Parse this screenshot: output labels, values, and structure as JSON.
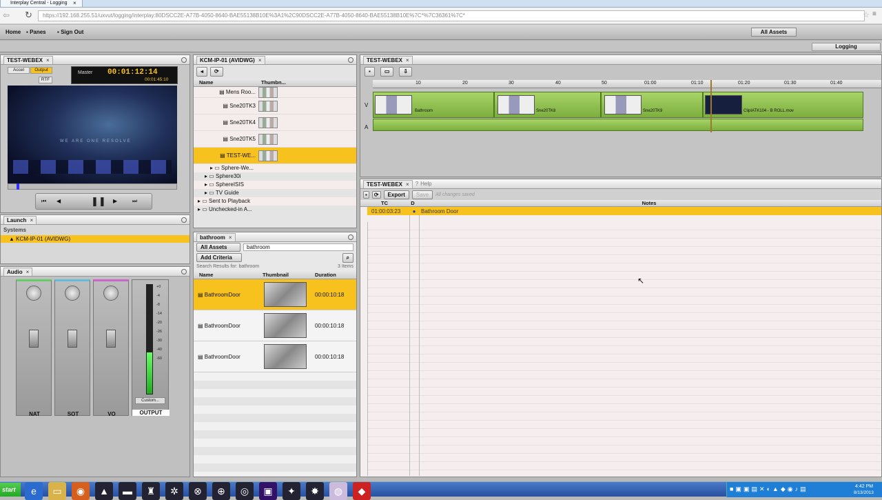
{
  "browser": {
    "tab_title": "Interplay Central - Logging",
    "url": "https://192.168.255.51/uxvut/logging/interplay:80DSCC2E-A77B-4050-8640-BAE55138B10E%3A1%2C90DSCC2E-A77B-4050-8640-BAE55138B10E%7C*%7C36361%7C*"
  },
  "menubar": {
    "home": "Home",
    "panes": "Panes",
    "signout": "Sign Out",
    "assets_dropdown": "All Assets",
    "logging_button": "Logging"
  },
  "player": {
    "tab": "TEST-WEBEX",
    "accel": "Accel",
    "output": "Output",
    "rtf": "RTF",
    "master": "Master",
    "timecode": "00:01:12:14",
    "duration": "00:01:45:10",
    "overlay_text": "WE ARE ONE RESOLVE"
  },
  "launch": {
    "tab": "Launch",
    "systems": "Systems",
    "system_item": "KCM-IP-01 (AVIDWG)"
  },
  "audio": {
    "tab": "Audio",
    "channels": [
      "NAT",
      "SOT",
      "VO"
    ],
    "output": "OUTPUT",
    "custom": "Custom...",
    "meter_scale": [
      "+0",
      "-4",
      "-8",
      "-14",
      "-20",
      "-26",
      "-30",
      "-40",
      "-60"
    ]
  },
  "browse": {
    "tab": "KCM-IP-01 (AVIDWG)",
    "col_name": "Name",
    "col_thumb": "Thumbn...",
    "items": [
      "Mens Roo...",
      "Sne20TK3",
      "Sne20TK4",
      "Sne20TK5",
      "TEST-WE..."
    ],
    "folders": [
      "Sphere-We...",
      "Sphere30i",
      "SphereISIS",
      "TV Guide",
      "Sent to Playback",
      "Unchecked-in A..."
    ]
  },
  "search": {
    "tab": "bathroom",
    "scope": "All Assets",
    "query": "bathroom",
    "add_criteria": "Add Criteria",
    "results_label": "Search Results for: bathroom",
    "count": "3 Items",
    "col_name": "Name",
    "col_thumb": "Thumbnail",
    "col_duration": "Duration",
    "results": [
      {
        "name": "BathroomDoor",
        "duration": "00:00:10:18"
      },
      {
        "name": "BathroomDoor",
        "duration": "00:00:10:18"
      },
      {
        "name": "BathroomDoor",
        "duration": "00:00:10:18"
      }
    ]
  },
  "sequence": {
    "tab": "TEST-WEBEX",
    "ruler": [
      "10",
      "20",
      "30",
      "40",
      "50",
      "01:00",
      "01:10",
      "01:20",
      "01:30",
      "01:40"
    ],
    "track_v": "V",
    "track_a": "A",
    "clips": [
      "Bathroom",
      "Sne20TK8",
      "Sne20TK9",
      "ClipIATK104 - B ROLL.mov"
    ]
  },
  "logging": {
    "tab": "TEST-WEBEX",
    "help_tab": "Help",
    "export": "Export",
    "save": "Save",
    "status": "All changes saved",
    "col_tc": "TC",
    "col_d": "D",
    "col_notes": "Notes",
    "rows": [
      {
        "tc": "01:00:03:23",
        "note": "Bathroom Door"
      }
    ]
  },
  "taskbar": {
    "start": "start",
    "time": "4:42 PM",
    "date": "8/13/2013"
  }
}
